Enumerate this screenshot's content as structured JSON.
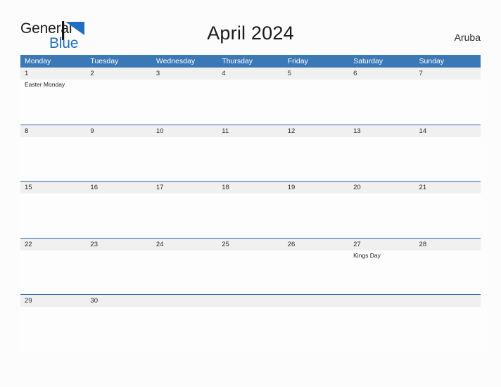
{
  "brand": {
    "name_part1": "General",
    "name_part2": "Blue",
    "flag_color": "#1f6fc4",
    "pole_color": "#141414"
  },
  "header": {
    "title": "April 2024",
    "region": "Aruba",
    "weekday_header_bg": "#3b78b6",
    "weekday_header_text": "#ffffff",
    "row_divider_color": "#2a6cae",
    "date_band_bg": "#f0f0f0"
  },
  "weekdays": [
    "Monday",
    "Tuesday",
    "Wednesday",
    "Thursday",
    "Friday",
    "Saturday",
    "Sunday"
  ],
  "weeks": [
    {
      "days": [
        {
          "date": "1",
          "events": [
            "Easter Monday"
          ]
        },
        {
          "date": "2",
          "events": []
        },
        {
          "date": "3",
          "events": []
        },
        {
          "date": "4",
          "events": []
        },
        {
          "date": "5",
          "events": []
        },
        {
          "date": "6",
          "events": []
        },
        {
          "date": "7",
          "events": []
        }
      ]
    },
    {
      "days": [
        {
          "date": "8",
          "events": []
        },
        {
          "date": "9",
          "events": []
        },
        {
          "date": "10",
          "events": []
        },
        {
          "date": "11",
          "events": []
        },
        {
          "date": "12",
          "events": []
        },
        {
          "date": "13",
          "events": []
        },
        {
          "date": "14",
          "events": []
        }
      ]
    },
    {
      "days": [
        {
          "date": "15",
          "events": []
        },
        {
          "date": "16",
          "events": []
        },
        {
          "date": "17",
          "events": []
        },
        {
          "date": "18",
          "events": []
        },
        {
          "date": "19",
          "events": []
        },
        {
          "date": "20",
          "events": []
        },
        {
          "date": "21",
          "events": []
        }
      ]
    },
    {
      "days": [
        {
          "date": "22",
          "events": []
        },
        {
          "date": "23",
          "events": []
        },
        {
          "date": "24",
          "events": []
        },
        {
          "date": "25",
          "events": []
        },
        {
          "date": "26",
          "events": []
        },
        {
          "date": "27",
          "events": [
            "Kings Day"
          ]
        },
        {
          "date": "28",
          "events": []
        }
      ]
    },
    {
      "days": [
        {
          "date": "29",
          "events": []
        },
        {
          "date": "30",
          "events": []
        },
        {
          "date": "",
          "events": []
        },
        {
          "date": "",
          "events": []
        },
        {
          "date": "",
          "events": []
        },
        {
          "date": "",
          "events": []
        },
        {
          "date": "",
          "events": []
        }
      ]
    }
  ]
}
